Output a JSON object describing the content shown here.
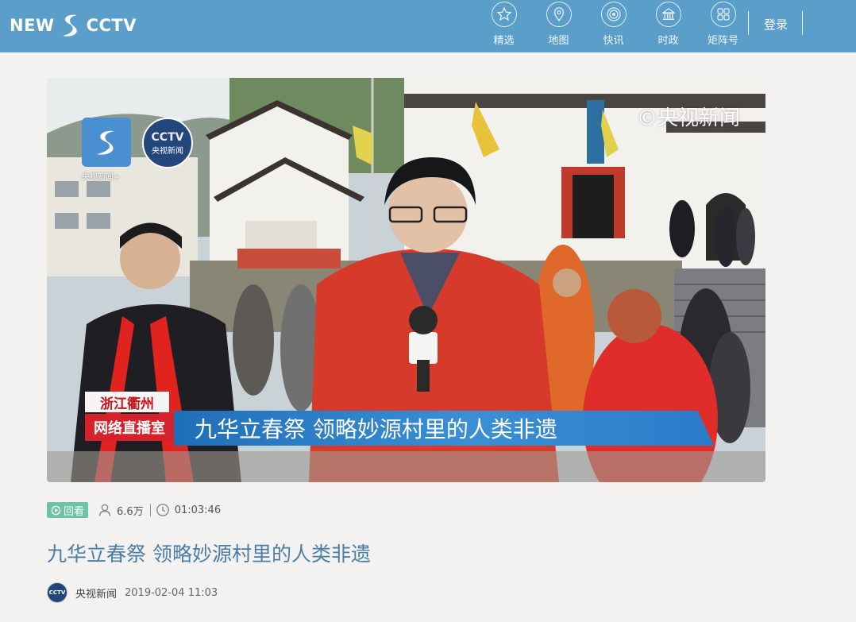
{
  "header": {
    "logo_left": "NEW",
    "logo_right": "CCTV",
    "nav": [
      {
        "label": "精选",
        "icon": "star-icon"
      },
      {
        "label": "地图",
        "icon": "map-pin-icon"
      },
      {
        "label": "快讯",
        "icon": "broadcast-icon"
      },
      {
        "label": "时政",
        "icon": "building-icon"
      },
      {
        "label": "矩阵号",
        "icon": "grid-icon"
      }
    ],
    "login": "登录"
  },
  "video": {
    "watermark": "©央视新闻",
    "corner_label": "央视新闻+",
    "cctv_logo": "CCTV",
    "cctv_sub": "央视新闻",
    "location": "浙江衢州",
    "studio": "网络直播室",
    "headline": "九华立春祭  领略妙源村里的人类非遗"
  },
  "meta": {
    "replay": "回看",
    "views": "6.6万",
    "duration": "01:03:46"
  },
  "article": {
    "title": "九华立春祭 领略妙源村里的人类非遗",
    "author": "央视新闻",
    "date": "2019-02-04 11:03",
    "avatar_text": "CCTV"
  },
  "colors": {
    "header_bg": "#5b9ec9",
    "title": "#4a7ea6",
    "replay_badge": "#6cc3a6",
    "headline_bar": "#2a7cc8",
    "studio_red": "#d6232b"
  }
}
